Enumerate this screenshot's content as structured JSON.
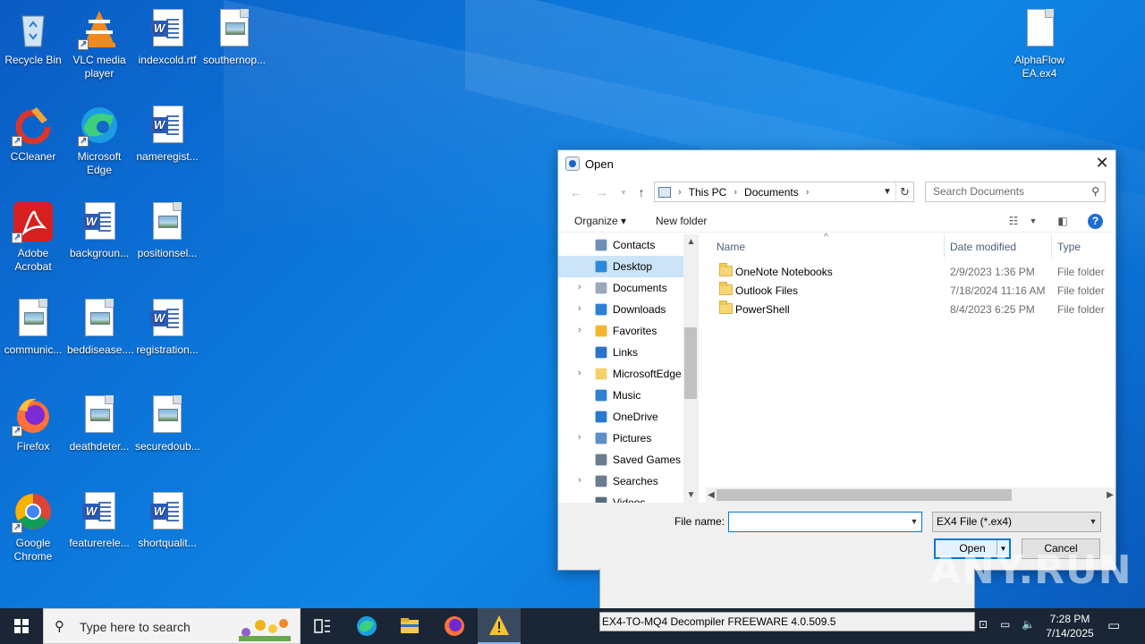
{
  "desktop": {
    "icons": [
      {
        "label": "Recycle Bin",
        "icon": "recycle-bin-icon"
      },
      {
        "label": "VLC media player",
        "icon": "vlc-icon"
      },
      {
        "label": "indexcold.rtf",
        "icon": "word-doc-icon"
      },
      {
        "label": "southernop...",
        "icon": "image-file-icon"
      },
      {
        "label": "CCleaner",
        "icon": "ccleaner-icon"
      },
      {
        "label": "Microsoft Edge",
        "icon": "edge-icon"
      },
      {
        "label": "nameregist...",
        "icon": "word-doc-icon"
      },
      {
        "label": "Adobe Acrobat",
        "icon": "acrobat-icon"
      },
      {
        "label": "backgroun...",
        "icon": "word-doc-icon"
      },
      {
        "label": "positionsel...",
        "icon": "image-file-icon"
      },
      {
        "label": "communic...",
        "icon": "image-file-icon"
      },
      {
        "label": "beddisease....",
        "icon": "image-file-icon"
      },
      {
        "label": "registration...",
        "icon": "word-doc-icon"
      },
      {
        "label": "Firefox",
        "icon": "firefox-icon"
      },
      {
        "label": "deathdeter...",
        "icon": "image-file-icon"
      },
      {
        "label": "securedoub...",
        "icon": "image-file-icon"
      },
      {
        "label": "Google Chrome",
        "icon": "chrome-icon"
      },
      {
        "label": "featurerele...",
        "icon": "word-doc-icon"
      },
      {
        "label": "shortqualit...",
        "icon": "word-doc-icon"
      },
      {
        "label": "AlphaFlow EA.ex4",
        "icon": "blank-file-icon"
      }
    ]
  },
  "dialog": {
    "title": "Open",
    "address": {
      "segments": [
        "This PC",
        "Documents"
      ]
    },
    "search_placeholder": "Search Documents",
    "toolbar": {
      "organize": "Organize",
      "new_folder": "New folder"
    },
    "nav_items": [
      {
        "label": "Contacts",
        "icon": "contacts-icon",
        "expandable": false,
        "selected": false
      },
      {
        "label": "Desktop",
        "icon": "desktop-icon",
        "expandable": false,
        "selected": true
      },
      {
        "label": "Documents",
        "icon": "documents-icon",
        "expandable": true,
        "selected": false
      },
      {
        "label": "Downloads",
        "icon": "downloads-icon",
        "expandable": true,
        "selected": false
      },
      {
        "label": "Favorites",
        "icon": "star-icon",
        "expandable": true,
        "selected": false
      },
      {
        "label": "Links",
        "icon": "links-icon",
        "expandable": false,
        "selected": false
      },
      {
        "label": "MicrosoftEdge",
        "icon": "folder-icon",
        "expandable": true,
        "selected": false
      },
      {
        "label": "Music",
        "icon": "music-icon",
        "expandable": false,
        "selected": false
      },
      {
        "label": "OneDrive",
        "icon": "cloud-icon",
        "expandable": false,
        "selected": false
      },
      {
        "label": "Pictures",
        "icon": "pictures-icon",
        "expandable": true,
        "selected": false
      },
      {
        "label": "Saved Games",
        "icon": "games-icon",
        "expandable": false,
        "selected": false
      },
      {
        "label": "Searches",
        "icon": "search-icon",
        "expandable": true,
        "selected": false
      },
      {
        "label": "Videos",
        "icon": "videos-icon",
        "expandable": false,
        "selected": false
      }
    ],
    "columns": {
      "name": "Name",
      "date": "Date modified",
      "type": "Type"
    },
    "files": [
      {
        "name": "OneNote Notebooks",
        "date": "2/9/2023 1:36 PM",
        "type": "File folder"
      },
      {
        "name": "Outlook Files",
        "date": "7/18/2024 11:16 AM",
        "type": "File folder"
      },
      {
        "name": "PowerShell",
        "date": "8/4/2023 6:25 PM",
        "type": "File folder"
      }
    ],
    "file_name_label": "File name:",
    "file_name_value": "",
    "file_type": "EX4 File (*.ex4)",
    "open_label": "Open",
    "cancel_label": "Cancel"
  },
  "background_app": {
    "status": "EX4-TO-MQ4 Decompiler FREEWARE  4.0.509.5"
  },
  "taskbar": {
    "search_placeholder": "Type here to search",
    "time": "7:28 PM",
    "date": "7/14/2025"
  },
  "watermark": "ANY.RUN"
}
